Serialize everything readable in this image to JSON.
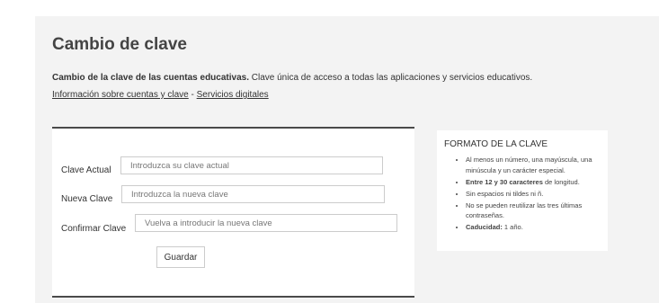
{
  "page": {
    "title": "Cambio de clave",
    "intro_bold": "Cambio de la clave de las cuentas educativas.",
    "intro_text": " Clave única de acceso a todas las aplicaciones y servicios educativos.",
    "link_info": "Información sobre cuentas y clave",
    "link_separator": " - ",
    "link_services": "Servicios digitales"
  },
  "form": {
    "current": {
      "label": "Clave Actual",
      "placeholder": "Introduzca su clave actual",
      "value": ""
    },
    "new": {
      "label": "Nueva Clave",
      "placeholder": "Introduzca la nueva clave",
      "value": ""
    },
    "confirm": {
      "label": "Confirmar Clave",
      "placeholder": "Vuelva a introducir la nueva clave",
      "value": ""
    },
    "save_label": "Guardar"
  },
  "format": {
    "title": "FORMATO DE LA CLAVE",
    "rules": [
      {
        "bold": "",
        "text": "Al menos un número, una mayúscula, una minúscula y un carácter especial."
      },
      {
        "bold": "Entre 12 y 30 caracteres",
        "text": " de longitud."
      },
      {
        "bold": "",
        "text": "Sin espacios ni tildes ni ñ."
      },
      {
        "bold": "",
        "text": "No se pueden reutilizar las tres últimas contraseñas."
      },
      {
        "bold": "Caducidad:",
        "text": " 1 año."
      }
    ]
  },
  "colors": {
    "panel_background": "#f3f3f3",
    "card_border": "#4a4a4a",
    "text": "#333333"
  }
}
